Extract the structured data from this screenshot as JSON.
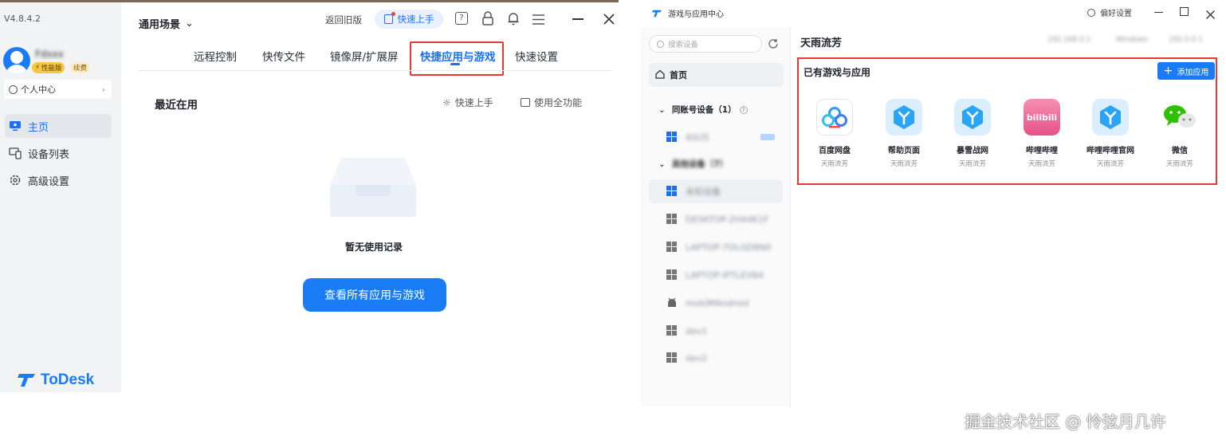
{
  "left": {
    "version": "V4.8.4.2",
    "user": {
      "name": "Fdxxx",
      "badge_perf": "性能版",
      "badge_renew": "续费",
      "center": "个人中心"
    },
    "sidebar": [
      {
        "label": "主页"
      },
      {
        "label": "设备列表"
      },
      {
        "label": "高级设置"
      }
    ],
    "brand": "ToDesk",
    "header": {
      "scene": "通用场景",
      "back_old": "返回旧版",
      "quick_start": "快速上手"
    },
    "tabs": [
      "远程控制",
      "快传文件",
      "镜像屏/扩展屏",
      "快捷应用与游戏",
      "快速设置"
    ],
    "section_title": "最近在用",
    "quick_start_link": "快速上手",
    "use_all": "使用全功能",
    "empty_text": "暂无使用记录",
    "view_all_button": "查看所有应用与游戏"
  },
  "right": {
    "title": "游戏与应用中心",
    "pref": "偏好设置",
    "search_placeholder": "搜索设备",
    "home": "首页",
    "same_account": "同账号设备（1）",
    "other_devices": "其他设备（7）",
    "devices": [
      "ASUS",
      "未知设备",
      "DESKTOP-2H44K1F",
      "LAPTOP-7OLGD8N0",
      "LAPTOP-IPTLEVB4",
      "mobiMAndroid",
      "dev1",
      "dev2"
    ],
    "device_name": "天雨流芳",
    "header_info": [
      "192.168.0.1",
      "Windows",
      "192.0.0.1"
    ],
    "section_title": "已有游戏与应用",
    "add_app": "添加应用",
    "apps": [
      {
        "name": "百度网盘",
        "owner": "天雨流芳"
      },
      {
        "name": "帮助页面",
        "owner": "天雨流芳"
      },
      {
        "name": "暴雪战网",
        "owner": "天雨流芳"
      },
      {
        "name": "哔哩哔哩",
        "owner": "天雨流芳",
        "logo": "bilibili"
      },
      {
        "name": "哔哩哔哩官网",
        "owner": "天雨流芳"
      },
      {
        "name": "微信",
        "owner": "天雨流芳"
      }
    ]
  },
  "watermark": "掘金技术社区 @ 怜弦月几许",
  "colors": {
    "accent": "#1a7cf5",
    "highlight_border": "#e53935",
    "sidebar_bg": "#f2f3f5"
  }
}
